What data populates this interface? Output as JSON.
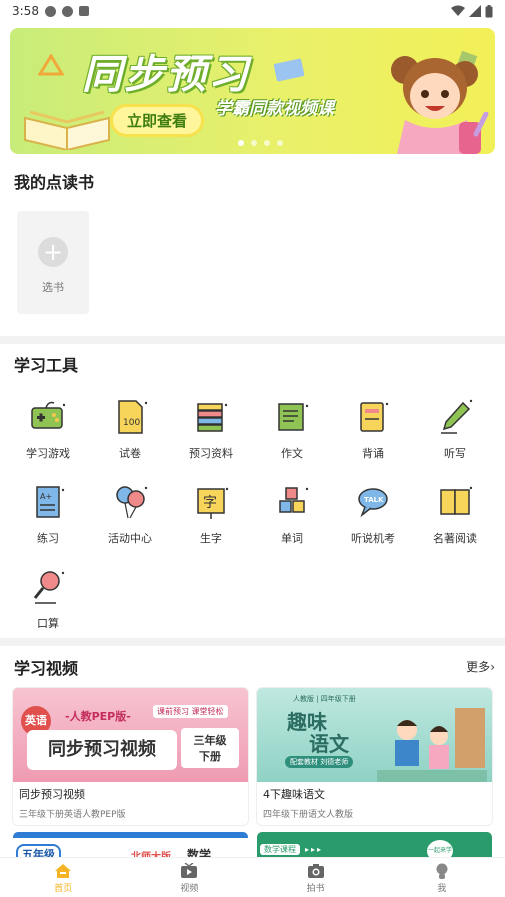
{
  "status_bar": {
    "time": "3:58"
  },
  "banner": {
    "title": "同步预习",
    "subtitle": "学霸同款视频课",
    "cta": "立即查看"
  },
  "my_books": {
    "title": "我的点读书",
    "add_label": "选书"
  },
  "tools": {
    "title": "学习工具",
    "items": [
      {
        "label": "学习游戏",
        "icon": "gamepad-icon"
      },
      {
        "label": "试卷",
        "icon": "exam-paper-icon"
      },
      {
        "label": "预习资料",
        "icon": "books-stack-icon"
      },
      {
        "label": "作文",
        "icon": "composition-icon"
      },
      {
        "label": "背诵",
        "icon": "recite-book-icon"
      },
      {
        "label": "听写",
        "icon": "pencil-icon"
      },
      {
        "label": "练习",
        "icon": "practice-paper-icon"
      },
      {
        "label": "活动中心",
        "icon": "balloons-icon"
      },
      {
        "label": "生字",
        "icon": "character-card-icon"
      },
      {
        "label": "单词",
        "icon": "letter-blocks-icon"
      },
      {
        "label": "听说机考",
        "icon": "talk-bubble-icon"
      },
      {
        "label": "名著阅读",
        "icon": "open-book-icon"
      },
      {
        "label": "口算",
        "icon": "magnifier-icon"
      }
    ]
  },
  "videos": {
    "title": "学习视频",
    "more_label": "更多",
    "items": [
      {
        "title": "同步预习视频",
        "sub": "三年级下册英语人教PEP版",
        "thumb": {
          "badge": "英语",
          "edition": "-人教PEP版-",
          "tag": "课前预习 课堂轻松",
          "main": "同步预习视频",
          "grade": "三年级",
          "term": "下册"
        }
      },
      {
        "title": "4下趣味语文",
        "sub": "四年级下册语文人教版",
        "thumb": {
          "top": "人教版 | 四年级下册",
          "main1": "趣味",
          "main2": "语文",
          "strip": "配套教材 刘德老师"
        }
      }
    ],
    "partial": [
      {
        "badge": "五年级",
        "text1": "北师大版",
        "text2": "数学"
      },
      {
        "tag": "数学课程",
        "badge": "一起来学"
      }
    ]
  },
  "tabbar": {
    "items": [
      {
        "label": "首页",
        "active": true
      },
      {
        "label": "视频",
        "active": false
      },
      {
        "label": "拍书",
        "active": false
      },
      {
        "label": "我",
        "active": false
      }
    ]
  },
  "colors": {
    "accent": "#f5b326",
    "banner_green": "#6fae2b"
  }
}
